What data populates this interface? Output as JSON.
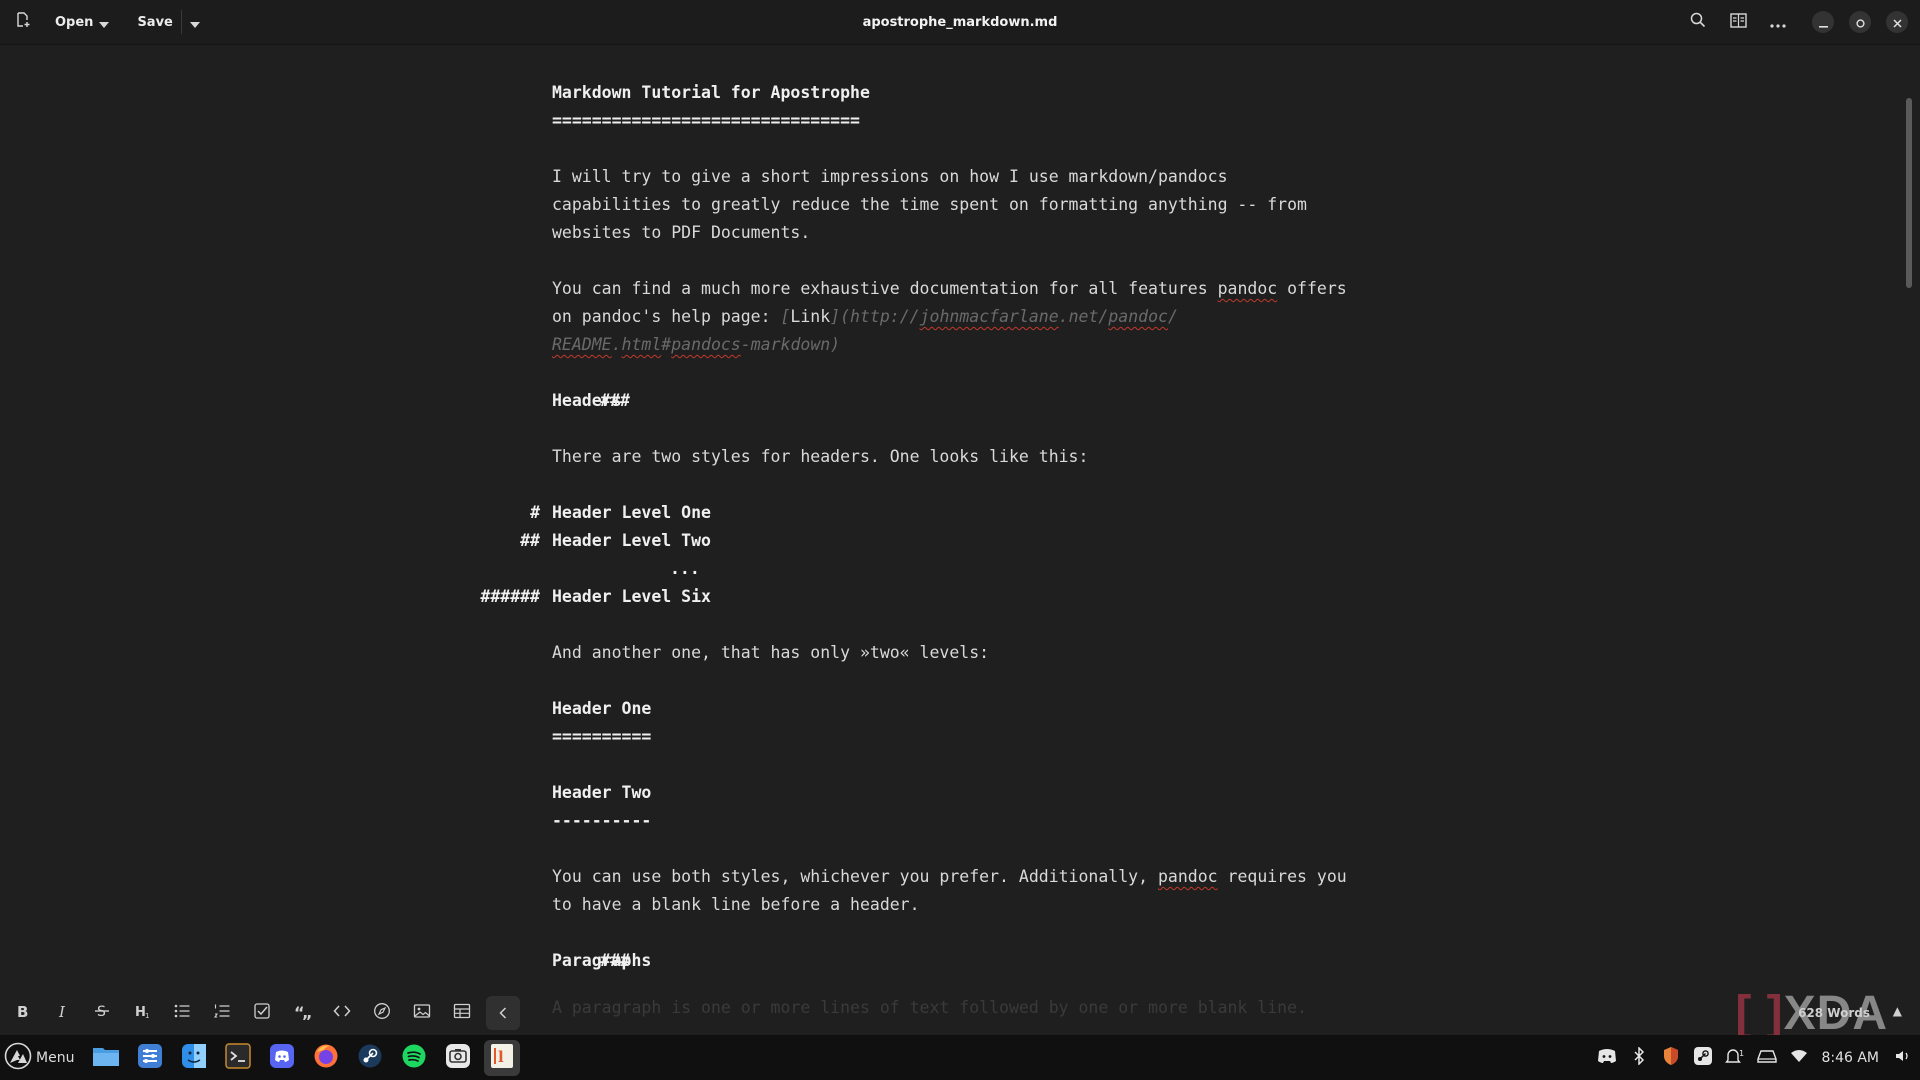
{
  "header": {
    "open_label": "Open",
    "save_label": "Save",
    "title": "apostrophe_markdown.md"
  },
  "editor": {
    "title": "Markdown Tutorial for Apostrophe",
    "title_rule": "===============================",
    "intro_1": "I will try to give a short impressions on how I use markdown/pandocs",
    "intro_2": "capabilities to greatly reduce the time spent on formatting anything -- from",
    "intro_3": "websites to PDF Documents.",
    "find_1a": "You can find a much more exhaustive documentation for all features ",
    "find_1b": "pandoc",
    "find_1c": " offers",
    "find_2a": "on pandoc's help page: ",
    "link_open": "[",
    "link_text": "Link",
    "link_mid": "](",
    "link_url_1a": "http://",
    "link_url_1b": "johnmacfarlane",
    "link_url_1c": ".net/",
    "link_url_1d": "pandoc",
    "link_url_1e": "/",
    "link_url_2a": "README",
    "link_url_2b": ".",
    "link_url_2c": "html",
    "link_url_2d": "#",
    "link_url_2e": "pandocs",
    "link_url_2f": "-markdown)",
    "h_headers_mark": "###",
    "h_headers": "Headers",
    "two_styles": "There are two styles for headers. One looks like this:",
    "h1_mark": "#",
    "h1_text": "Header Level One",
    "h2_mark": "##",
    "h2_text": "Header Level Two",
    "ellipsis": "...",
    "h6_mark": "######",
    "h6_text": "Header Level Six",
    "another": "And another one, that has only »two« levels:",
    "header_one": "Header One",
    "header_one_rule": "==========",
    "header_two": "Header Two",
    "header_two_rule": "----------",
    "both_1a": "You can use both styles, whichever you prefer. Additionally, ",
    "both_1b": "pandoc",
    "both_1c": " requires you",
    "both_2": "to have a blank line before a header.",
    "h_paragraphs_mark": "###",
    "h_paragraphs": "Paragraphs",
    "faded_line": "A paragraph is one or more lines of text followed by one or more blank line."
  },
  "formatbar": {
    "word_count": "628 Words"
  },
  "watermark": "XDA",
  "taskbar": {
    "menu_label": "Menu",
    "clock": "8:46 AM"
  }
}
